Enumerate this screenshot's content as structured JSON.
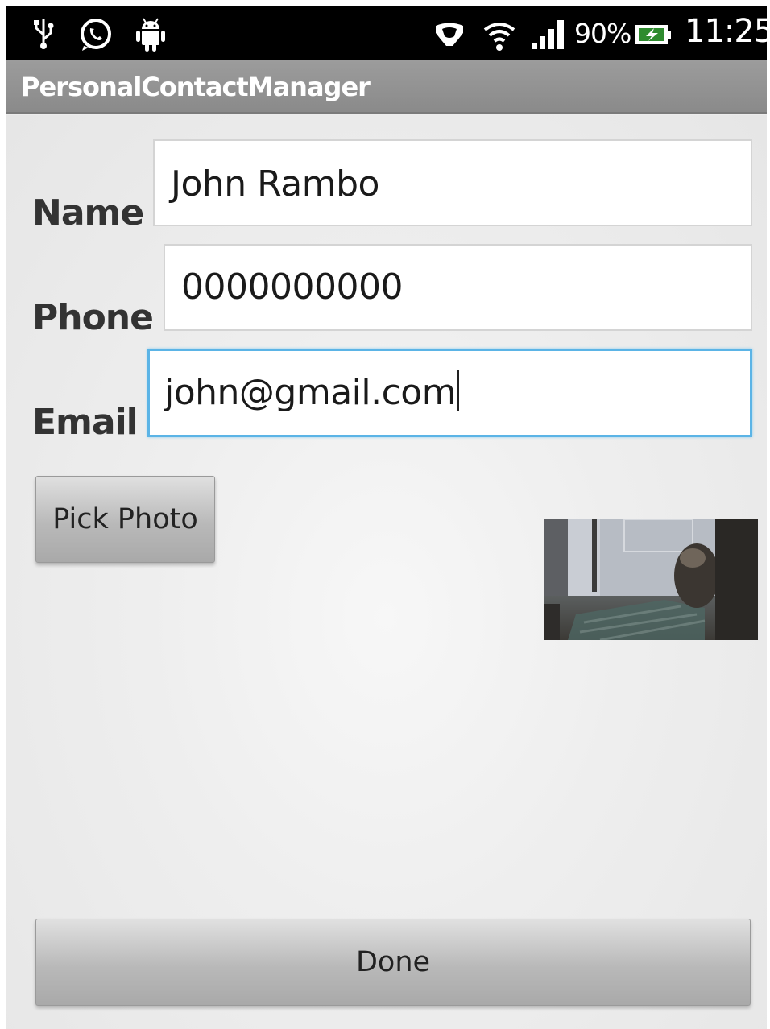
{
  "status_bar": {
    "icons_left": [
      "usb-icon",
      "whatsapp-icon",
      "android-icon"
    ],
    "icons_right": [
      "headset-icon",
      "wifi-icon",
      "signal-icon",
      "battery-charging-icon"
    ],
    "battery_percent": "90%",
    "time": "11:25"
  },
  "app": {
    "title": "PersonalContactManager"
  },
  "form": {
    "name_label": "Name",
    "name_value": "John Rambo",
    "phone_label": "Phone",
    "phone_value": "0000000000",
    "email_label": "Email",
    "email_value": "john@gmail.com"
  },
  "buttons": {
    "pick_photo": "Pick Photo",
    "done": "Done"
  },
  "colors": {
    "status_bar": "#000000",
    "title_bar": "#919191",
    "focus_border": "#5bb4e6",
    "background": "#ececec"
  }
}
